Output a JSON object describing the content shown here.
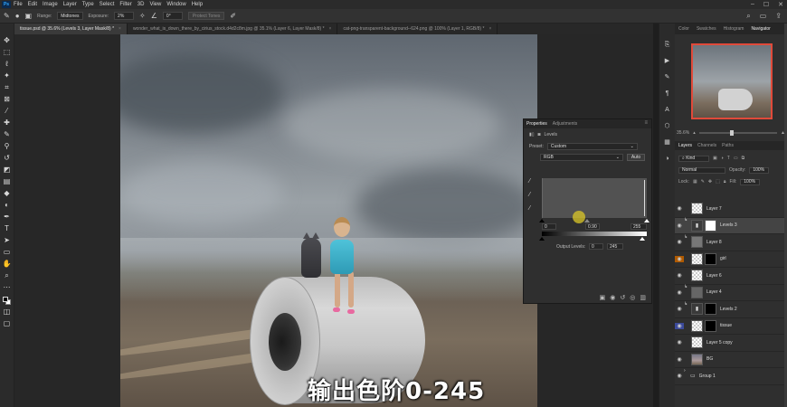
{
  "menu": {
    "logo": "Ps",
    "items": [
      "File",
      "Edit",
      "Image",
      "Layer",
      "Type",
      "Select",
      "Filter",
      "3D",
      "View",
      "Window",
      "Help"
    ]
  },
  "options": {
    "range_label": "Range:",
    "range_value": "Midtones",
    "exposure_label": "Exposure:",
    "exposure_value": "2%",
    "angle_value": "0°",
    "protect_tones": "Protect Tones"
  },
  "tabs": [
    {
      "label": "tissue.psd @ 35.6% (Levels 3, Layer Mask/8) *",
      "active": true
    },
    {
      "label": "wonder_what_is_down_there_by_cirius_stock.d4d2c8m.jpg @ 35.1% (Layer 6, Layer Mask/8) *",
      "active": false
    },
    {
      "label": "cat-png-transparent-background--624.png @ 100% (Layer 1, RGB/8) *",
      "active": false
    }
  ],
  "properties": {
    "tab_properties": "Properties",
    "tab_adjustments": "Adjustments",
    "title": "Levels",
    "preset_label": "Preset:",
    "preset_value": "Custom",
    "channel_value": "RGB",
    "auto_label": "Auto",
    "input_black": "0",
    "input_mid": "0.90",
    "input_white": "255",
    "output_label": "Output Levels:",
    "output_black": "0",
    "output_white": "245"
  },
  "navigator": {
    "tabs": [
      "Color",
      "Swatches",
      "Histogram",
      "Navigator"
    ],
    "active_tab": "Navigator",
    "zoom": "35.6%"
  },
  "layers_panel": {
    "tabs": [
      "Layers",
      "Channels",
      "Paths"
    ],
    "kind_label": "Kind",
    "blend_mode": "Normal",
    "opacity_label": "Opacity:",
    "opacity_value": "100%",
    "lock_label": "Lock:",
    "fill_label": "Fill:",
    "fill_value": "100%",
    "layers": [
      {
        "name": "Layer 7",
        "selected": false
      },
      {
        "name": "Levels 3",
        "selected": true
      },
      {
        "name": "Layer 8",
        "selected": false
      },
      {
        "name": "girl",
        "selected": false
      },
      {
        "name": "Layer 6",
        "selected": false
      },
      {
        "name": "Layer 4",
        "selected": false
      },
      {
        "name": "Levels 2",
        "selected": false
      },
      {
        "name": "tissue",
        "selected": false
      },
      {
        "name": "Layer 5 copy",
        "selected": false
      },
      {
        "name": "BG",
        "selected": false
      },
      {
        "name": "Group 1",
        "selected": false
      }
    ]
  },
  "subtitle": "输出色阶0-245"
}
